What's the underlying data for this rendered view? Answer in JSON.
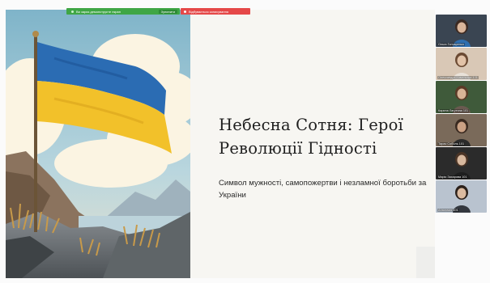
{
  "slide": {
    "title_line1": "Небесна Сотня: Герої",
    "title_line2": "Революції Гідності",
    "subtitle": "Символ мужності, самопожертви і незламної боротьби за України"
  },
  "toolbar": {
    "share_label": "Ви зараз демонструєте екран",
    "stop_label": "Зупинити",
    "recording_label": "Відбувається записування"
  },
  "participants": [
    {
      "name": "Ольга Гончаренко",
      "bg": "#3a4552",
      "skin": "#d9b59a",
      "hair": "#3c2a22",
      "shirt": "#2f6fb0"
    },
    {
      "name": "Олександра Каменська 101",
      "bg": "#d9c8b6",
      "skin": "#e2c3a8",
      "hair": "#6b4a33",
      "shirt": "#e9e2d9"
    },
    {
      "name": "Карина Лагутина 101",
      "bg": "#3f5a3a",
      "skin": "#d8b496",
      "hair": "#5a3a26",
      "shirt": "#6a5a50"
    },
    {
      "name": "Тарас Соболь 101",
      "bg": "#7a6a5a",
      "skin": "#caa184",
      "hair": "#3a2a20",
      "shirt": "#2b2b2b"
    },
    {
      "name": "Марія Захарова 101",
      "bg": "#2b2b2b",
      "skin": "#d7b89e",
      "hair": "#4a3426",
      "shirt": "#1e1e1e"
    },
    {
      "name": "Анастасія 101",
      "bg": "#b9c3cf",
      "skin": "#dcbba0",
      "hair": "#2c211b",
      "shirt": "#34383f"
    }
  ],
  "colors": {
    "flag_blue": "#2b6cb3",
    "flag_yellow": "#f2c12a",
    "share_green": "#3fa645",
    "record_red": "#e54848"
  }
}
